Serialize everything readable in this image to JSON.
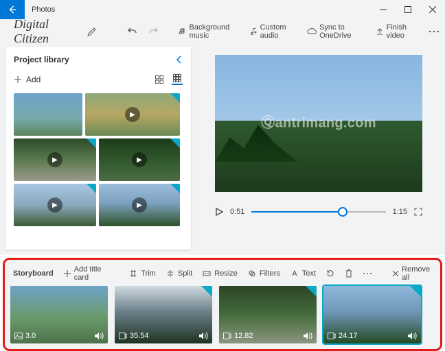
{
  "window": {
    "title": "Photos"
  },
  "project": {
    "name": "Digital Citizen"
  },
  "toolbar": {
    "bg_music": "Background music",
    "custom_audio": "Custom audio",
    "sync": "Sync to OneDrive",
    "finish": "Finish video"
  },
  "library": {
    "title": "Project library",
    "add_label": "Add"
  },
  "preview": {
    "current_time": "0:51",
    "total_time": "1:15"
  },
  "storyboard": {
    "title": "Storyboard",
    "add_title_card": "Add title card",
    "trim": "Trim",
    "split": "Split",
    "resize": "Resize",
    "filters": "Filters",
    "text": "Text",
    "remove_all": "Remove all",
    "clips": [
      {
        "duration": "3.0",
        "is_photo": true,
        "selected": false
      },
      {
        "duration": "35.54",
        "is_photo": false,
        "selected": false
      },
      {
        "duration": "12.82",
        "is_photo": false,
        "selected": false
      },
      {
        "duration": "24.17",
        "is_photo": false,
        "selected": true
      }
    ]
  }
}
